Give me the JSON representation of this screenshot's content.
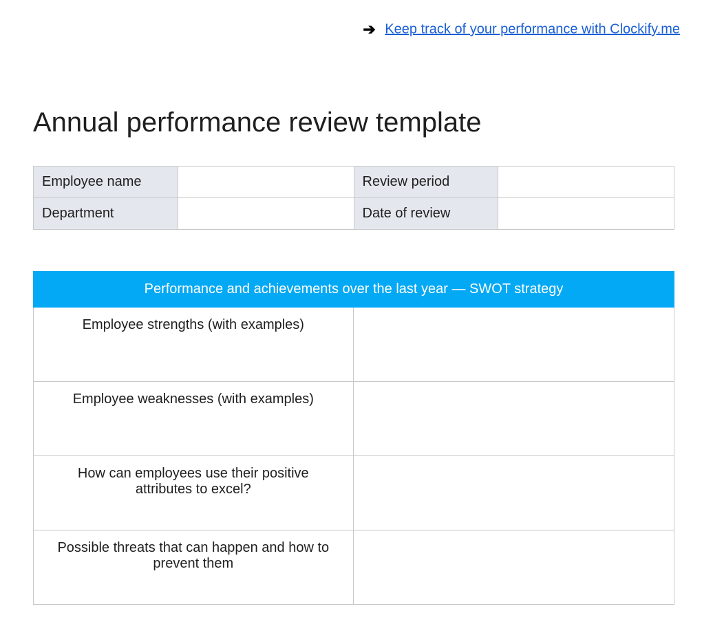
{
  "header": {
    "link_text": "Keep track of your performance with Clockify.me"
  },
  "title": "Annual performance review template",
  "info_table": {
    "rows": [
      {
        "label1": "Employee name",
        "value1": "",
        "label2": "Review period",
        "value2": ""
      },
      {
        "label1": "Department",
        "value1": "",
        "label2": "Date of review",
        "value2": ""
      }
    ]
  },
  "swot": {
    "header": "Performance and achievements over the last year — SWOT strategy",
    "rows": [
      {
        "label": "Employee strengths (with examples)",
        "value": ""
      },
      {
        "label": "Employee weaknesses (with examples)",
        "value": ""
      },
      {
        "label": "How can employees use their positive attributes to excel?",
        "value": ""
      },
      {
        "label": "Possible threats that can happen and how to prevent them",
        "value": ""
      }
    ]
  }
}
